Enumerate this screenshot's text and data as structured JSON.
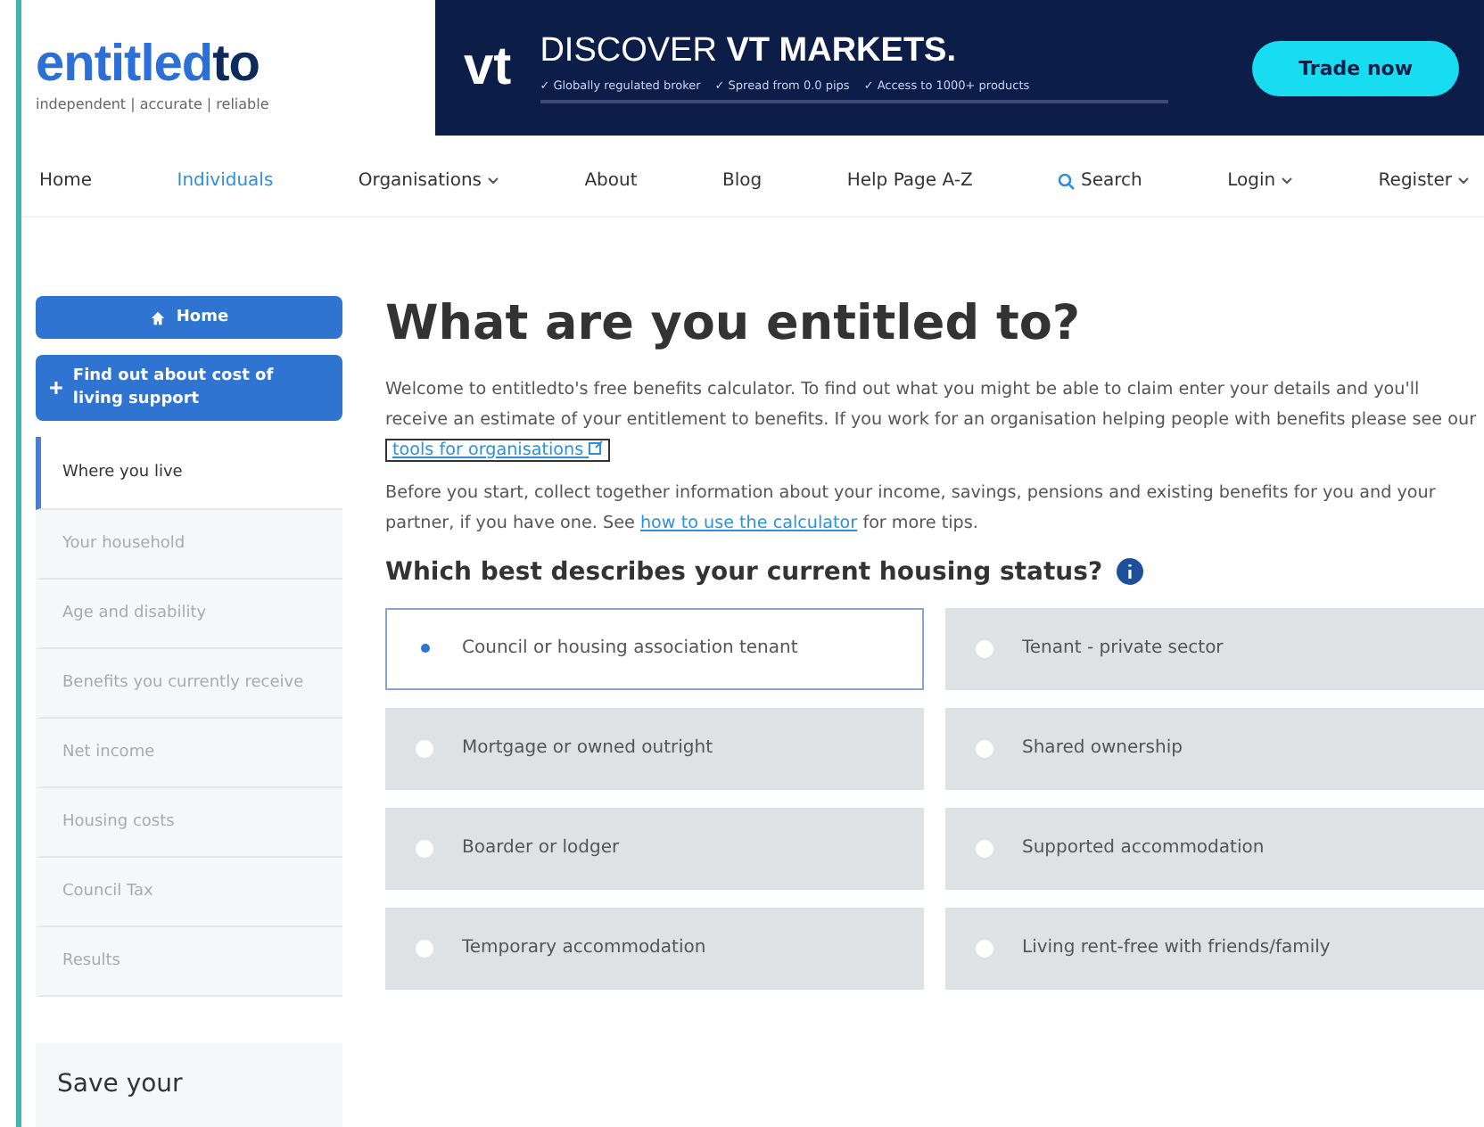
{
  "logo": {
    "name_start": "entitled",
    "name_end": "to",
    "tagline": "independent | accurate | reliable"
  },
  "ad": {
    "brand": "vt",
    "headline_start": "DISCOVER",
    "headline_end": "VT MARKETS.",
    "points": [
      "✓ Globally regulated broker",
      "✓ Spread from 0.0 pips",
      "✓ Access to 1000+ products"
    ],
    "cta": "Trade now"
  },
  "nav": {
    "items": [
      {
        "label": "Home",
        "selected": false,
        "dropdown": false
      },
      {
        "label": "Individuals",
        "selected": true,
        "dropdown": false
      },
      {
        "label": "Organisations",
        "selected": false,
        "dropdown": true
      },
      {
        "label": "About",
        "selected": false,
        "dropdown": false
      },
      {
        "label": "Blog",
        "selected": false,
        "dropdown": false
      },
      {
        "label": "Help Page A-Z",
        "selected": false,
        "dropdown": false
      }
    ],
    "search": "Search",
    "login": "Login",
    "register": "Register"
  },
  "sidebar": {
    "home": "Home",
    "cost_of_living": "Find out about cost of living support",
    "steps": [
      {
        "label": "Where you live",
        "selected": true
      },
      {
        "label": "Your household",
        "selected": false
      },
      {
        "label": "Age and disability",
        "selected": false
      },
      {
        "label": "Benefits you currently receive",
        "selected": false
      },
      {
        "label": "Net income",
        "selected": false
      },
      {
        "label": "Housing costs",
        "selected": false
      },
      {
        "label": "Council Tax",
        "selected": false
      },
      {
        "label": "Results",
        "selected": false
      }
    ],
    "save_title": "Save your"
  },
  "main": {
    "title": "What are you entitled to?",
    "intro": "Welcome to entitledto's free benefits calculator. To find out what you might be able to claim enter your details and you'll receive an estimate of your entitlement to benefits. If you work for an organisation helping people with benefits please see our",
    "intro_link": "tools for organisations",
    "before_start": "Before you start, collect together information about your income, savings, pensions and existing benefits for you and your partner, if you have one. See",
    "before_link": "how to use the calculator",
    "before_end": "for more tips.",
    "question": "Which best describes your current housing status?",
    "options": [
      {
        "label": "Council or housing association tenant",
        "selected": true
      },
      {
        "label": "Tenant - private sector",
        "selected": false
      },
      {
        "label": "Mortgage or owned outright",
        "selected": false
      },
      {
        "label": "Shared ownership",
        "selected": false
      },
      {
        "label": "Boarder or lodger",
        "selected": false
      },
      {
        "label": "Supported accommodation",
        "selected": false
      },
      {
        "label": "Temporary accommodation",
        "selected": false
      },
      {
        "label": "Living rent-free with friends/family",
        "selected": false
      }
    ]
  }
}
